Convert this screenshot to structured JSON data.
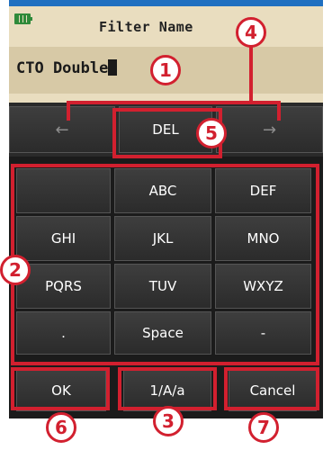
{
  "display": {
    "title": "Filter Name",
    "input_value": "CTO Double"
  },
  "nav": {
    "left_arrow": "←",
    "del_label": "DEL",
    "right_arrow": "→"
  },
  "keypad": {
    "keys": [
      "",
      "ABC",
      "DEF",
      "GHI",
      "JKL",
      "MNO",
      "PQRS",
      "TUV",
      "WXYZ",
      ".",
      "Space",
      "-"
    ]
  },
  "bottom": {
    "ok_label": "OK",
    "mode_label": "1/A/a",
    "cancel_label": "Cancel"
  },
  "callouts": {
    "n1": "1",
    "n2": "2",
    "n3": "3",
    "n4": "4",
    "n5": "5",
    "n6": "6",
    "n7": "7"
  },
  "colors": {
    "callout_red": "#d2202f",
    "banner_blue": "#1f6fc0",
    "display_bg": "#e9ddbf",
    "battery_green": "#2f8a3a"
  }
}
